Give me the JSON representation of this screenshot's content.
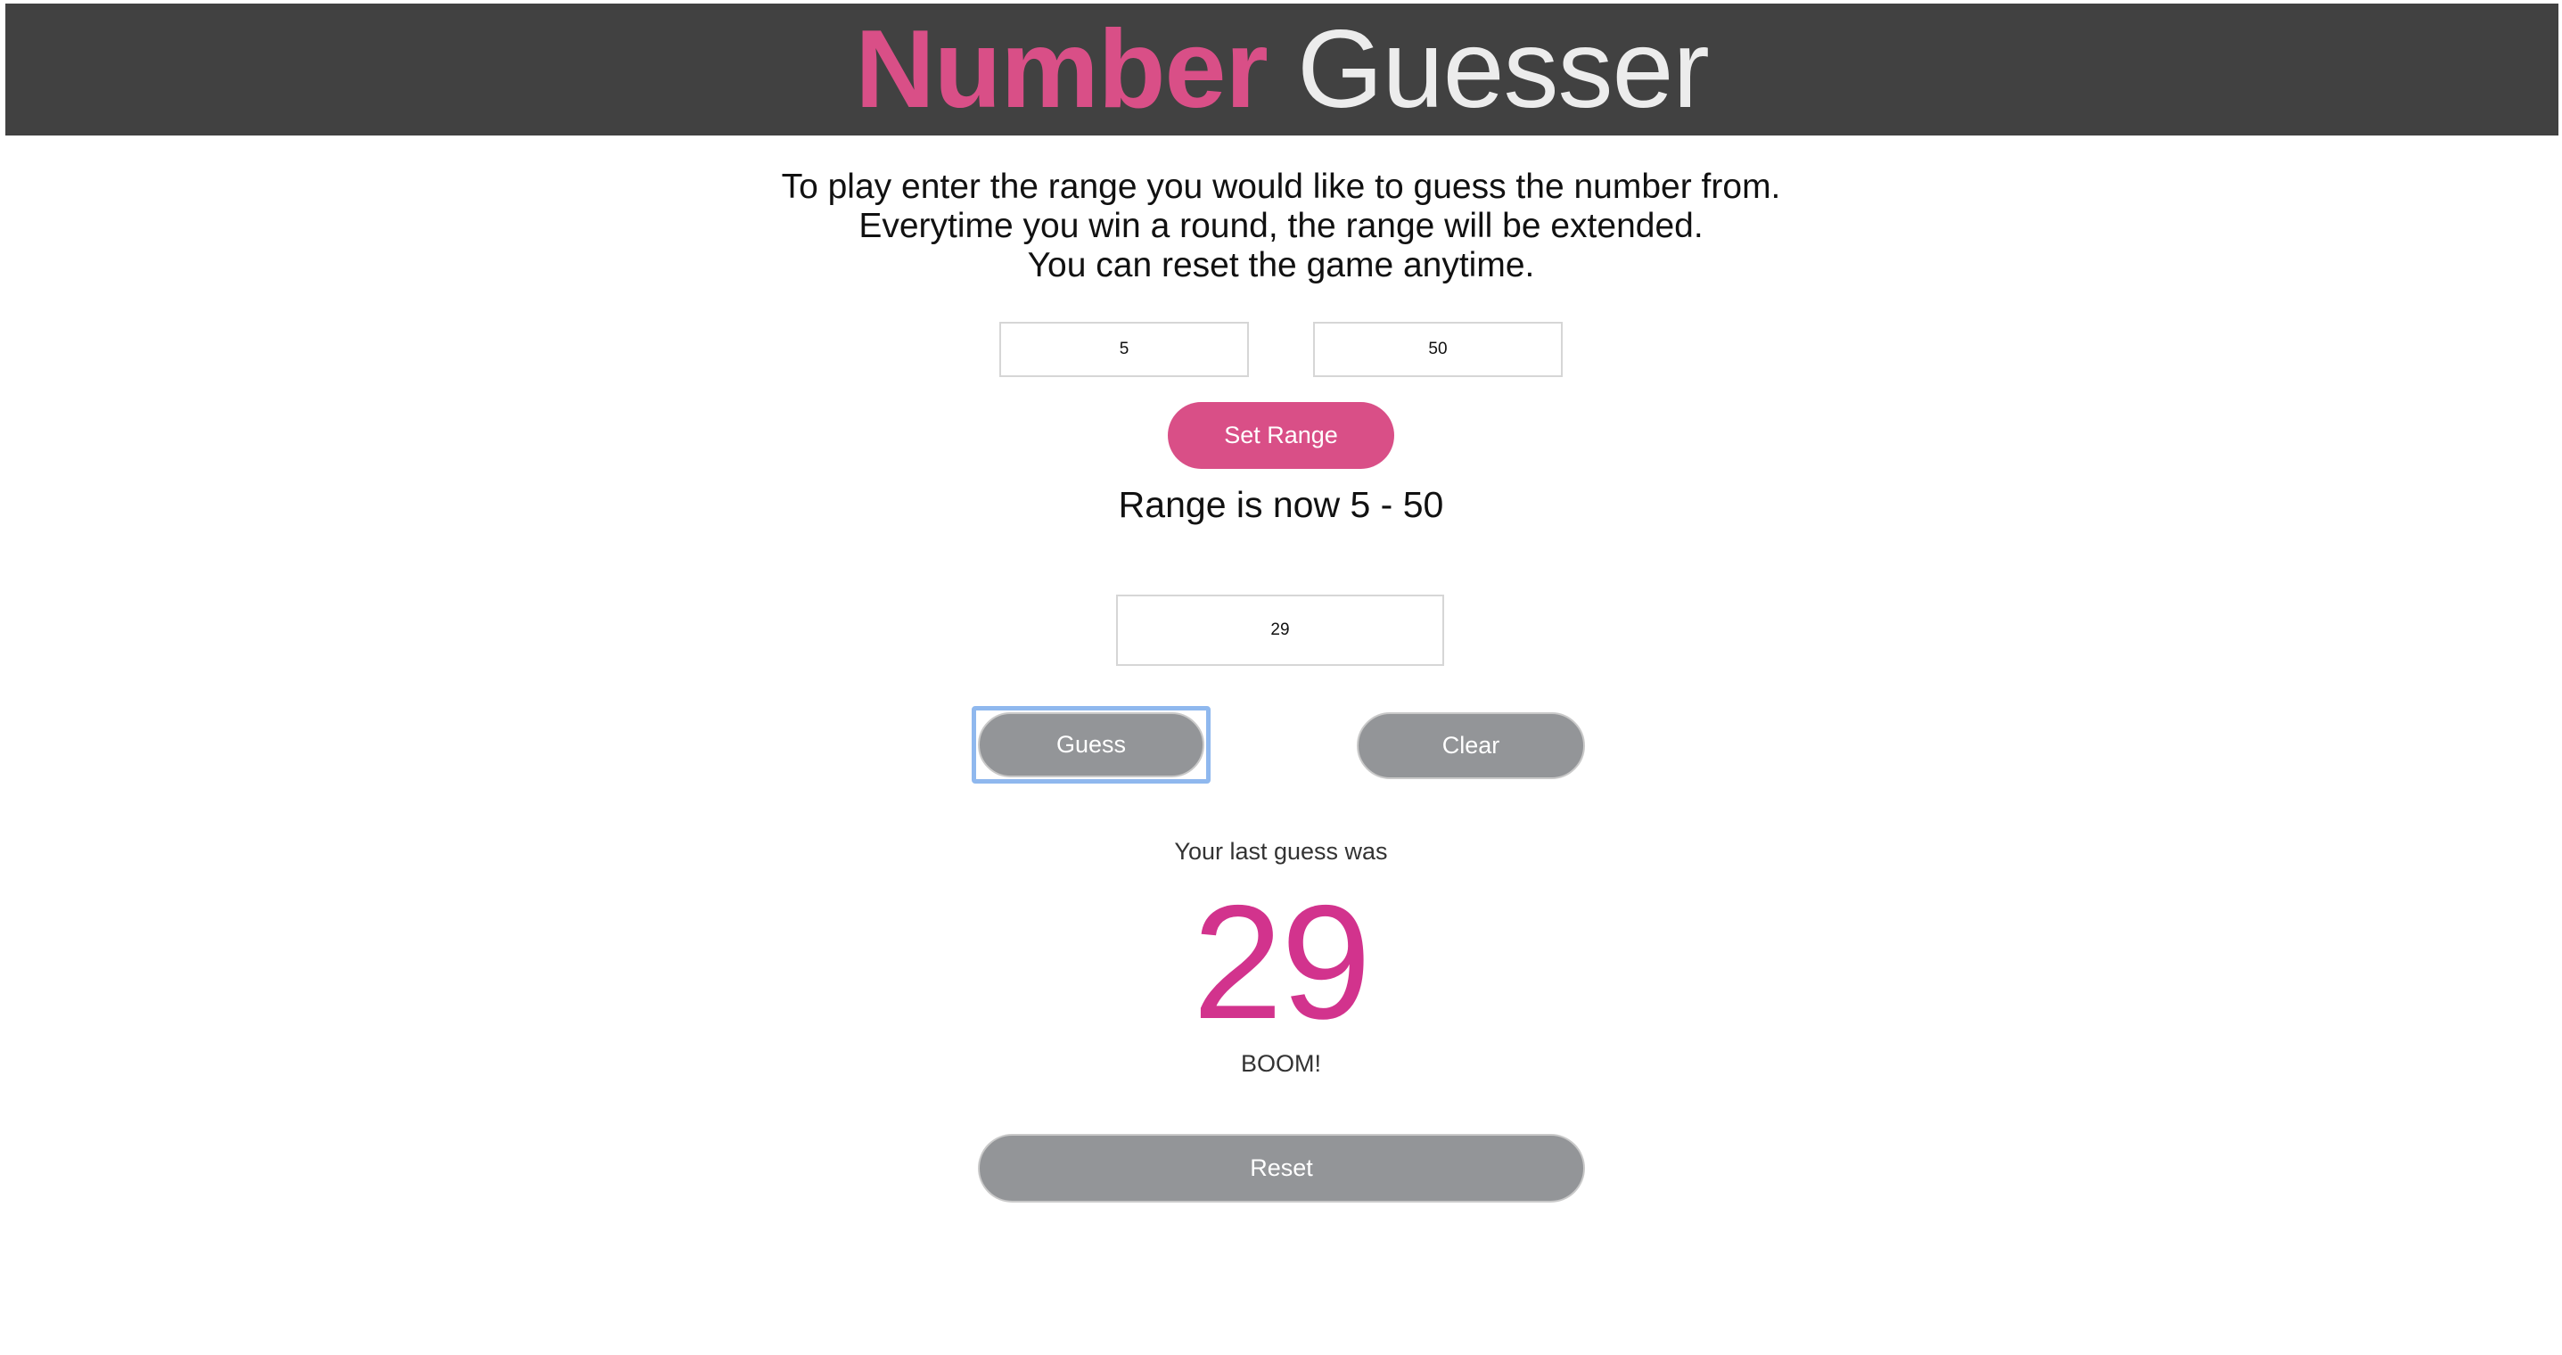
{
  "header": {
    "title_accent": "Number",
    "title_rest": "Guesser",
    "accent_color": "#d94f87",
    "background_color": "#414141"
  },
  "instructions": {
    "line1": "To play enter the range you would like to guess the number from.",
    "line2": "Everytime you win a round, the range will be extended.",
    "line3": "You can reset the game anytime."
  },
  "range": {
    "min_value": "5",
    "max_value": "50",
    "set_button_label": "Set Range",
    "status_text": "Range is now 5 - 50"
  },
  "guess": {
    "input_value": "29",
    "guess_button_label": "Guess",
    "clear_button_label": "Clear",
    "guess_button_focused": true
  },
  "result": {
    "label": "Your last guess was",
    "value": "29",
    "message": "BOOM!",
    "value_color": "#d2338d"
  },
  "reset": {
    "button_label": "Reset"
  }
}
